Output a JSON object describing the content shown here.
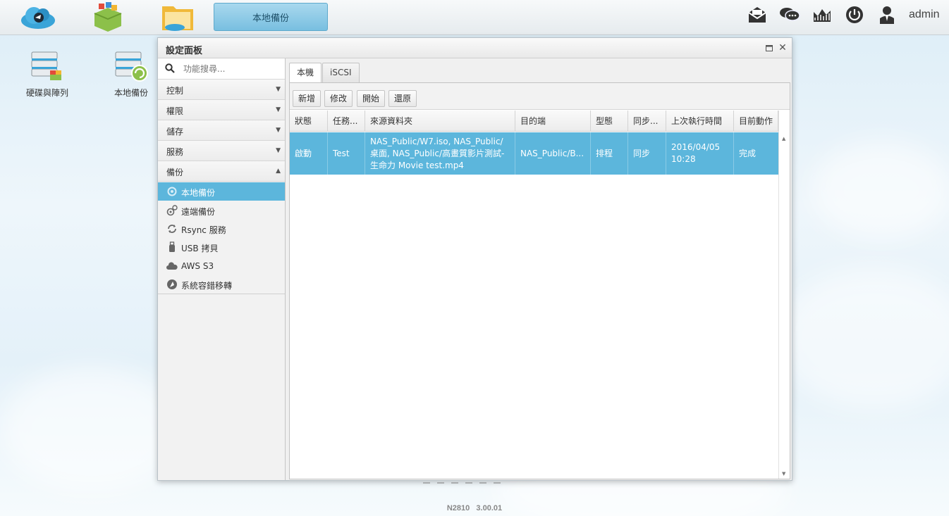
{
  "taskbar": {
    "active_task": "本地備份",
    "user": "admin"
  },
  "desktop": {
    "icons": [
      {
        "label": "硬碟與陣列",
        "icon": "disk-array-icon"
      },
      {
        "label": "本地備份",
        "icon": "local-backup-icon"
      }
    ]
  },
  "window": {
    "title": "設定面板"
  },
  "sidebar": {
    "search_placeholder": "功能搜尋...",
    "categories": [
      {
        "label": "控制",
        "expanded": false
      },
      {
        "label": "權限",
        "expanded": false
      },
      {
        "label": "儲存",
        "expanded": false
      },
      {
        "label": "服務",
        "expanded": false
      },
      {
        "label": "備份",
        "expanded": true
      }
    ],
    "backup_items": [
      {
        "label": "本地備份",
        "icon": "local-backup-icon",
        "active": true
      },
      {
        "label": "遠端備份",
        "icon": "remote-backup-icon",
        "active": false
      },
      {
        "label": "Rsync 服務",
        "icon": "rsync-icon",
        "active": false
      },
      {
        "label": "USB 拷貝",
        "icon": "usb-icon",
        "active": false
      },
      {
        "label": "AWS S3",
        "icon": "cloud-icon",
        "active": false
      },
      {
        "label": "系統容錯移轉",
        "icon": "failover-icon",
        "active": false
      }
    ]
  },
  "tabs": [
    {
      "label": "本機",
      "active": true
    },
    {
      "label": "iSCSI",
      "active": false
    }
  ],
  "toolbar": {
    "add": "新增",
    "edit": "修改",
    "start": "開始",
    "restore": "還原"
  },
  "table": {
    "columns": [
      "狀態",
      "任務...",
      "來源資料夾",
      "目的端",
      "型態",
      "同步...",
      "上次執行時間",
      "目前動作"
    ],
    "rows": [
      {
        "status": "啟動",
        "task": "Test",
        "source": "NAS_Public/W7.iso, NAS_Public/桌面, NAS_Public/高畫質影片測試-生命力 Movie test.mp4",
        "destination": "NAS_Public/B...",
        "type": "排程",
        "sync": "同步",
        "last_run": "2016/04/05 10:28",
        "current_action": "完成",
        "selected": true
      }
    ]
  },
  "footer": {
    "version": "N2810   3.00.01"
  },
  "colors": {
    "selection": "#5cb6dc",
    "task_button": "#78bfe0"
  }
}
